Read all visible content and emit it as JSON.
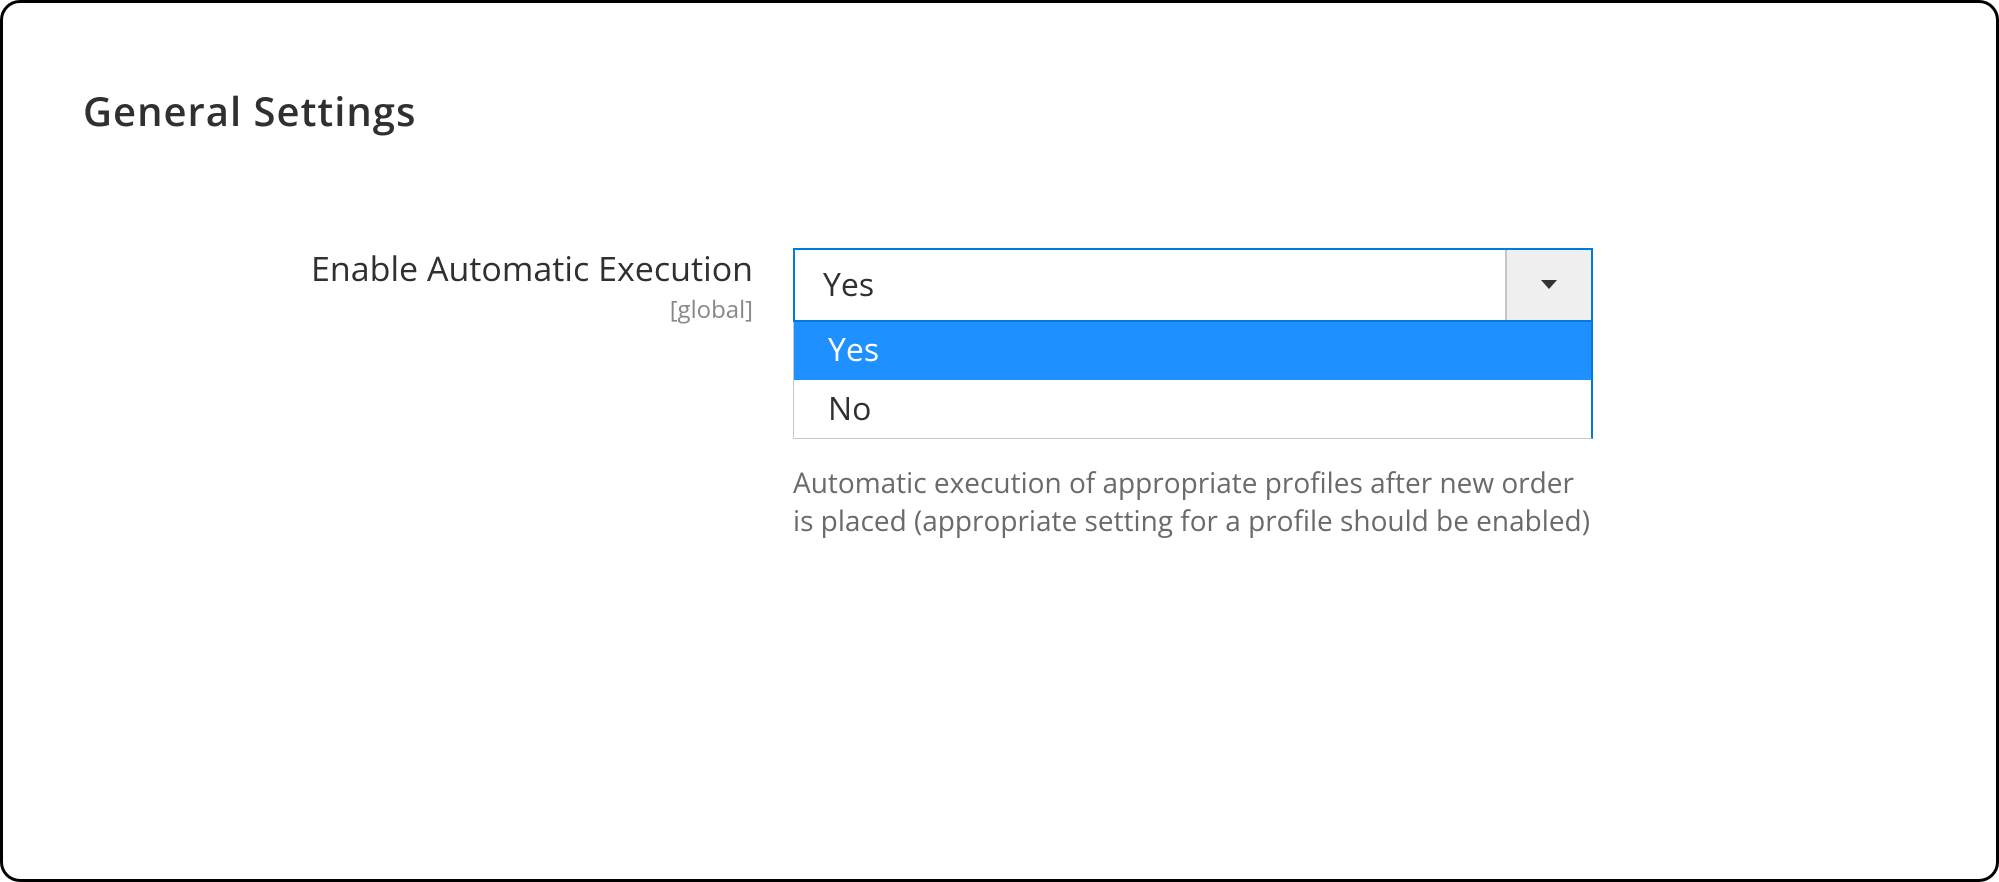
{
  "section": {
    "title": "General Settings"
  },
  "field": {
    "label": "Enable Automatic Execution",
    "scope": "[global]",
    "selected_value": "Yes",
    "options": [
      "Yes",
      "No"
    ],
    "comment": "Automatic execution of appropriate profiles after new order is placed (appropriate setting for a profile should be enabled)"
  }
}
